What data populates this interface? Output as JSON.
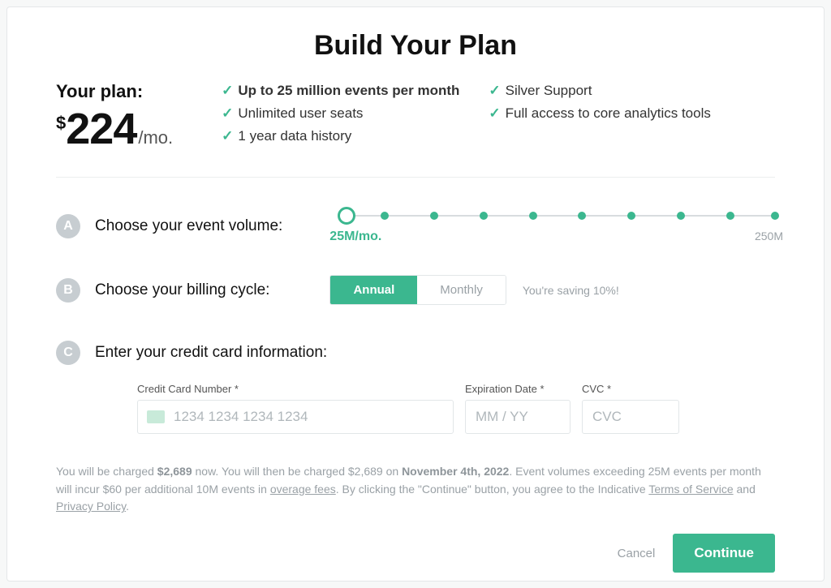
{
  "title": "Build Your Plan",
  "plan": {
    "label": "Your plan:",
    "currency": "$",
    "price": "224",
    "period": "/mo."
  },
  "features": [
    "Up to 25 million events per month",
    "Silver Support",
    "Unlimited user seats",
    "Full access to core analytics tools",
    "1 year data history"
  ],
  "steps": {
    "a": {
      "badge": "A",
      "label": "Choose your event volume:"
    },
    "b": {
      "badge": "B",
      "label": "Choose your billing cycle:"
    },
    "c": {
      "badge": "C",
      "label": "Enter your credit card information:"
    }
  },
  "slider": {
    "selected_label": "25M/mo.",
    "max_label": "250M"
  },
  "billing": {
    "annual": "Annual",
    "monthly": "Monthly",
    "saving_note": "You're saving 10%!",
    "selected": "annual"
  },
  "cc": {
    "number_label": "Credit Card Number *",
    "number_placeholder": "1234 1234 1234 1234",
    "exp_label": "Expiration Date *",
    "exp_placeholder": "MM / YY",
    "cvc_label": "CVC *",
    "cvc_placeholder": "CVC"
  },
  "legal": {
    "pre1": "You will be charged ",
    "amount1": "$2,689",
    "mid1": " now. You will then be charged $2,689 on ",
    "date": "November 4th, 2022",
    "post1": ". Event volumes exceeding 25M events per month will incur $60 per additional 10M events in ",
    "overage": "overage fees",
    "post2": ". By clicking the \"Continue\" button, you agree to the Indicative ",
    "tos": "Terms of Service",
    "and": " and ",
    "privacy": "Privacy Policy",
    "end": "."
  },
  "actions": {
    "cancel": "Cancel",
    "continue": "Continue"
  }
}
